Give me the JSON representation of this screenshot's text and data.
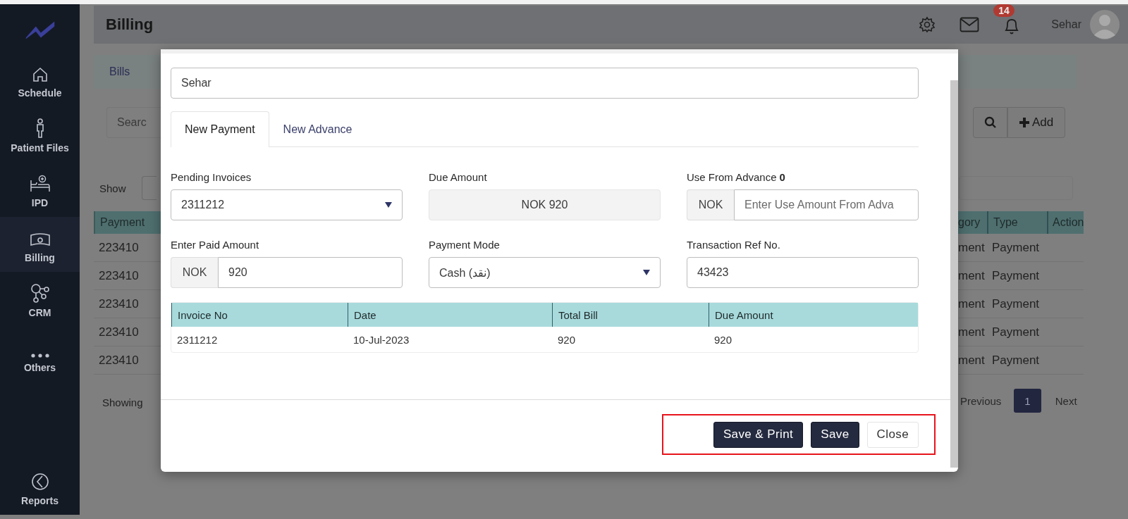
{
  "sidebar": {
    "items": [
      {
        "label": "Schedule",
        "selected": false
      },
      {
        "label": "Patient Files",
        "selected": false
      },
      {
        "label": "IPD",
        "selected": false
      },
      {
        "label": "Billing",
        "selected": true
      },
      {
        "label": "CRM",
        "selected": false
      },
      {
        "label": "Others",
        "selected": false
      }
    ],
    "footer_item": {
      "label": "Reports",
      "selected": false
    }
  },
  "header": {
    "title": "Billing",
    "notification_count": "14",
    "user_name": "Sehar"
  },
  "background_left": {
    "tab": "Bills",
    "search_placeholder": "Searc",
    "show_label": "Show",
    "column": "Payment",
    "cells": [
      "223410",
      "223410",
      "223410",
      "223410",
      "223410"
    ],
    "info": "Showing"
  },
  "background_right": {
    "add_button": "Add",
    "columns": [
      "gory",
      "Type",
      "Action"
    ],
    "rows": [
      [
        "ment",
        "Payment"
      ],
      [
        "ment",
        "Payment"
      ],
      [
        "ment",
        "Payment"
      ],
      [
        "ment",
        "Payment"
      ],
      [
        "ment",
        "Payment"
      ]
    ],
    "pagination": [
      {
        "label": "Previous",
        "selected": false
      },
      {
        "label": "1",
        "selected": true
      },
      {
        "label": "Next",
        "selected": false
      }
    ]
  },
  "modal": {
    "patient": "Sehar",
    "tabs": [
      {
        "label": "New Payment",
        "selected": true
      },
      {
        "label": "New Advance",
        "selected": false
      }
    ],
    "fields": [
      {
        "kind": "select",
        "label": "Pending Invoices",
        "value": "2311212"
      },
      {
        "kind": "readonly",
        "label": "Due Amount",
        "value": "NOK 920"
      },
      {
        "kind": "addon",
        "label": "Use From Advance **0**",
        "addon": "NOK",
        "placeholder": "Enter Use Amount From Adva"
      },
      {
        "kind": "addon",
        "label": "Enter Paid Amount",
        "addon": "NOK",
        "value": "920"
      },
      {
        "kind": "select",
        "label": "Payment Mode",
        "value": "Cash (نقد)"
      },
      {
        "kind": "text",
        "label": "Transaction Ref No.",
        "value": "43423"
      }
    ],
    "table": {
      "columns": [
        "Invoice No",
        "Date",
        "Total Bill",
        "Due Amount"
      ],
      "rows": [
        [
          "2311212",
          "10-Jul-2023",
          "920",
          "920"
        ]
      ]
    },
    "buttons": [
      {
        "label": "Save & Print",
        "kind": "primary"
      },
      {
        "label": "Save",
        "kind": "primary"
      },
      {
        "label": "Close",
        "kind": "secondary"
      }
    ]
  }
}
